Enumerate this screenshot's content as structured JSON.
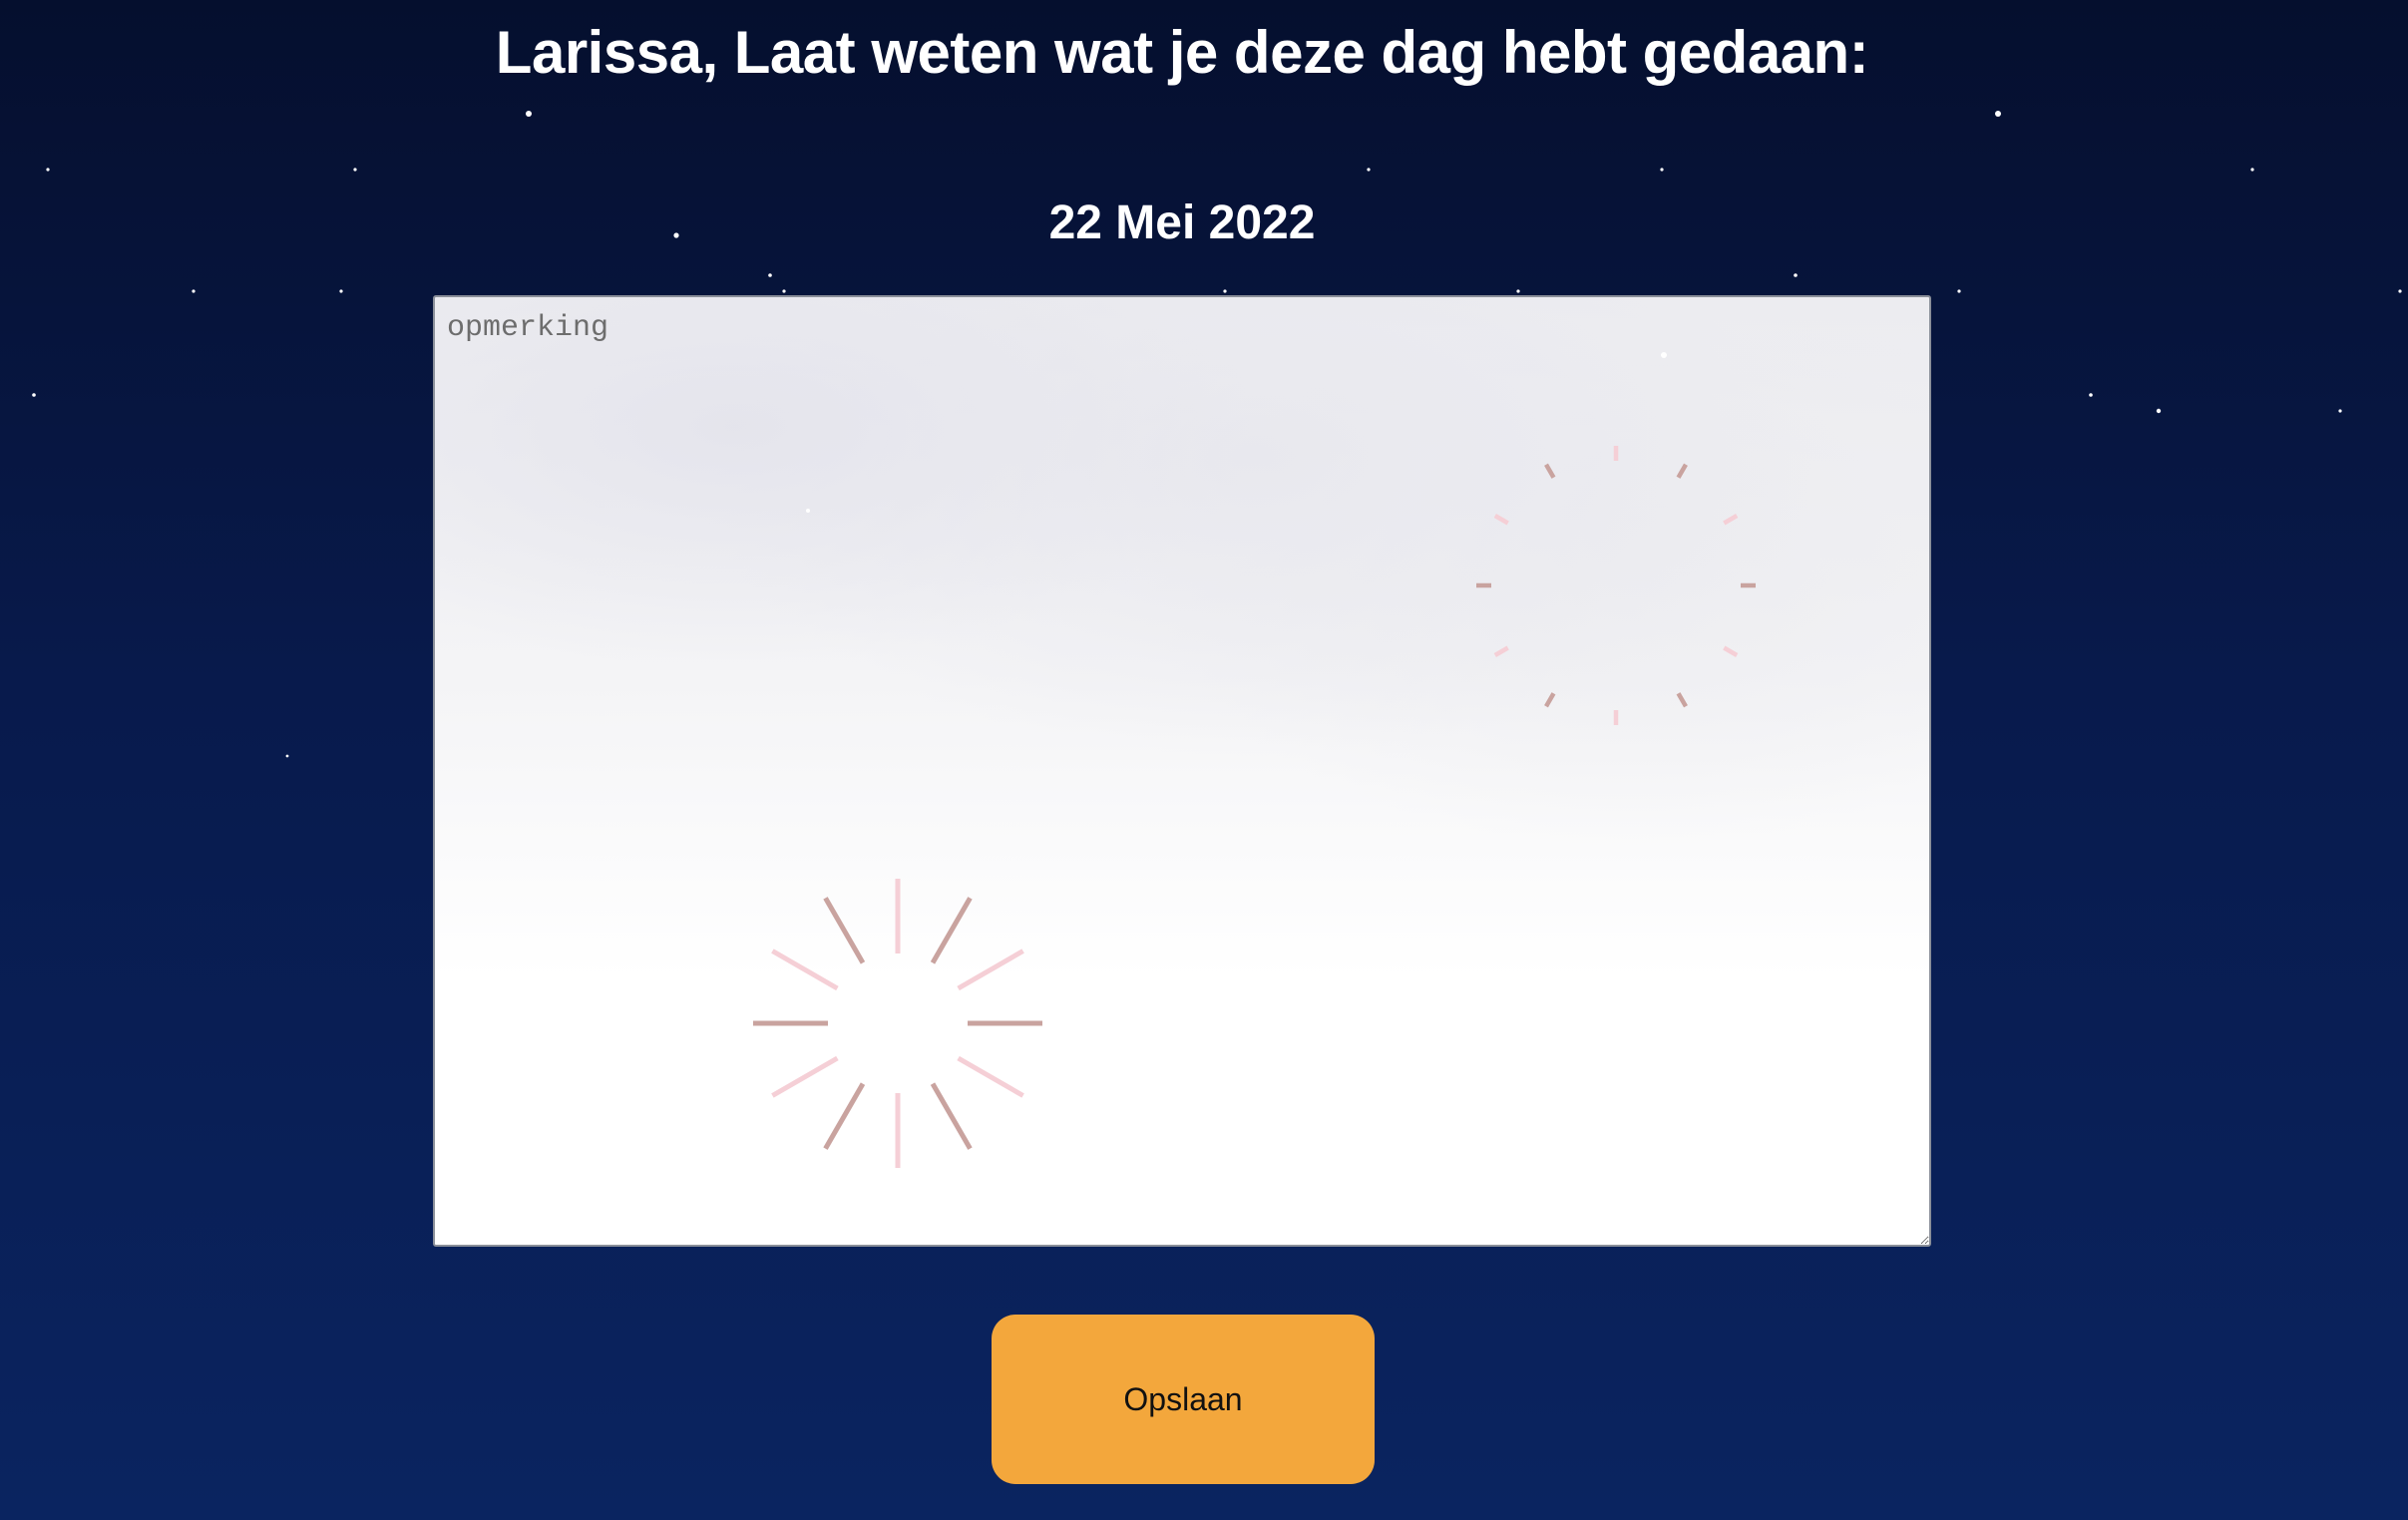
{
  "header": {
    "title": "Larissa, Laat weten wat je deze dag hebt gedaan:",
    "date": "22 Mei 2022"
  },
  "note": {
    "placeholder": "opmerking",
    "value": ""
  },
  "actions": {
    "save_label": "Opslaan"
  },
  "colors": {
    "background_top": "#050f2e",
    "background_bottom": "#0a2460",
    "button": "#f3a73c",
    "firework_dark": "#c9a39f",
    "firework_light": "#f5cfd6"
  }
}
